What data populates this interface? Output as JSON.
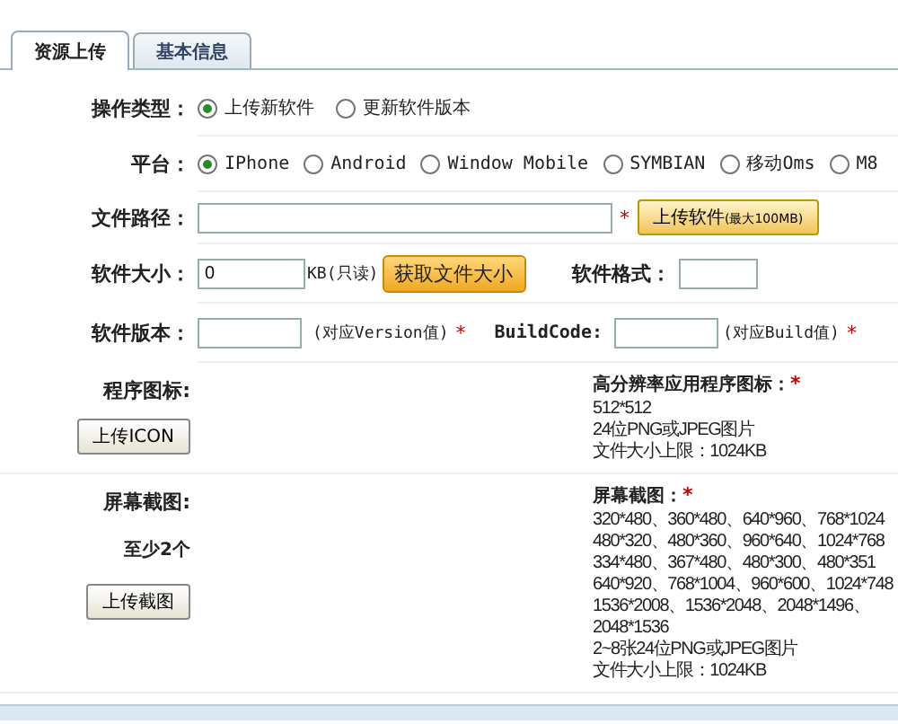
{
  "tabs": [
    {
      "label": "资源上传",
      "selected": true
    },
    {
      "label": "基本信息",
      "selected": false
    }
  ],
  "form": {
    "operation": {
      "label": "操作类型：",
      "options": [
        {
          "label": "上传新软件",
          "selected": true
        },
        {
          "label": "更新软件版本",
          "selected": false
        }
      ]
    },
    "platform": {
      "label": "平台：",
      "options": [
        {
          "label": "IPhone",
          "selected": true
        },
        {
          "label": "Android",
          "selected": false
        },
        {
          "label": "Window Mobile",
          "selected": false
        },
        {
          "label": "SYMBIAN",
          "selected": false
        },
        {
          "label": "移动Oms",
          "selected": false
        },
        {
          "label": "M8",
          "selected": false
        }
      ]
    },
    "file_path": {
      "label": "文件路径：",
      "required_mark": "*",
      "button": "上传软件",
      "button_note": "(最大100MB)"
    },
    "size": {
      "label": "软件大小：",
      "value": "0",
      "unit": "KB(只读)",
      "button": "获取文件大小",
      "format_label": "软件格式："
    },
    "version": {
      "label": "软件版本：",
      "note": "(对应Version值)",
      "required_mark": "*",
      "build_label": "BuildCode:",
      "build_note": "(对应Build值)",
      "build_required_mark": "*"
    },
    "icon": {
      "label": "程序图标:",
      "button": "上传ICON",
      "info_title": "高分辨率应用程序图标：",
      "required_mark": "*",
      "info_lines": [
        "512*512",
        "24位PNG或JPEG图片",
        "文件大小上限：1024KB"
      ]
    },
    "screenshots": {
      "label": "屏幕截图:",
      "hint": "至少2个",
      "button": "上传截图",
      "info_title": "屏幕截图：",
      "required_mark": "*",
      "info_lines": [
        "320*480、360*480、640*960、768*1024",
        "480*320、480*360、960*640、1024*768",
        "334*480、367*480、480*300、480*351",
        "640*920、768*1004、960*600、1024*748",
        "1536*2008、1536*2048、2048*1496、",
        "2048*1536",
        "2~8张24位PNG或JPEG图片",
        "文件大小上限：1024KB"
      ]
    }
  }
}
